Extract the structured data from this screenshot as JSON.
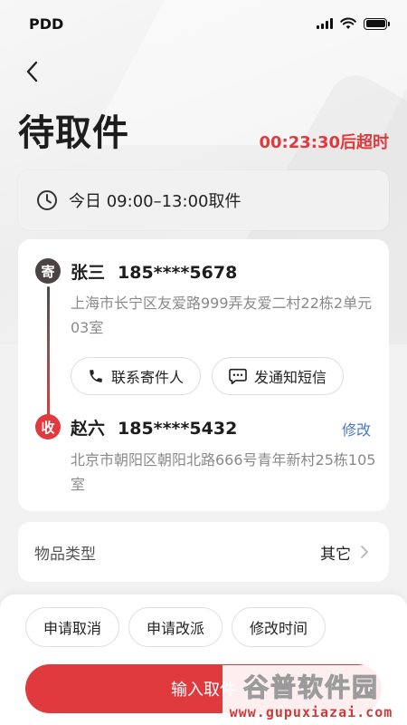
{
  "status_bar": {
    "carrier": "PDD"
  },
  "header": {
    "title": "待取件",
    "countdown": "00:23:30后超时"
  },
  "pickup_time": {
    "text": "今日 09:00–13:00取件"
  },
  "sender": {
    "badge": "寄",
    "name": "张三",
    "phone": "185****5678",
    "address": "上海市长宁区友爱路999弄友爱二村22栋2单元03室",
    "actions": [
      {
        "label": "联系寄件人",
        "icon": "phone-icon"
      },
      {
        "label": "发通知短信",
        "icon": "sms-icon"
      }
    ]
  },
  "receiver": {
    "badge": "收",
    "name": "赵六",
    "phone": "185****5432",
    "address": "北京市朝阳区朝阳北路666号青年新村25栋105室",
    "edit_label": "修改"
  },
  "item_type": {
    "label": "物品类型",
    "value": "其它"
  },
  "bottom": {
    "secondary_actions": [
      "申请取消",
      "申请改派",
      "修改时间"
    ],
    "primary_label": "输入取件"
  },
  "watermark": {
    "main": "谷普软件园",
    "sub": "www.gupuxiazai.com"
  },
  "colors": {
    "accent": "#e0393e",
    "link": "#4a79c7",
    "sender_badge": "#4b4444"
  }
}
